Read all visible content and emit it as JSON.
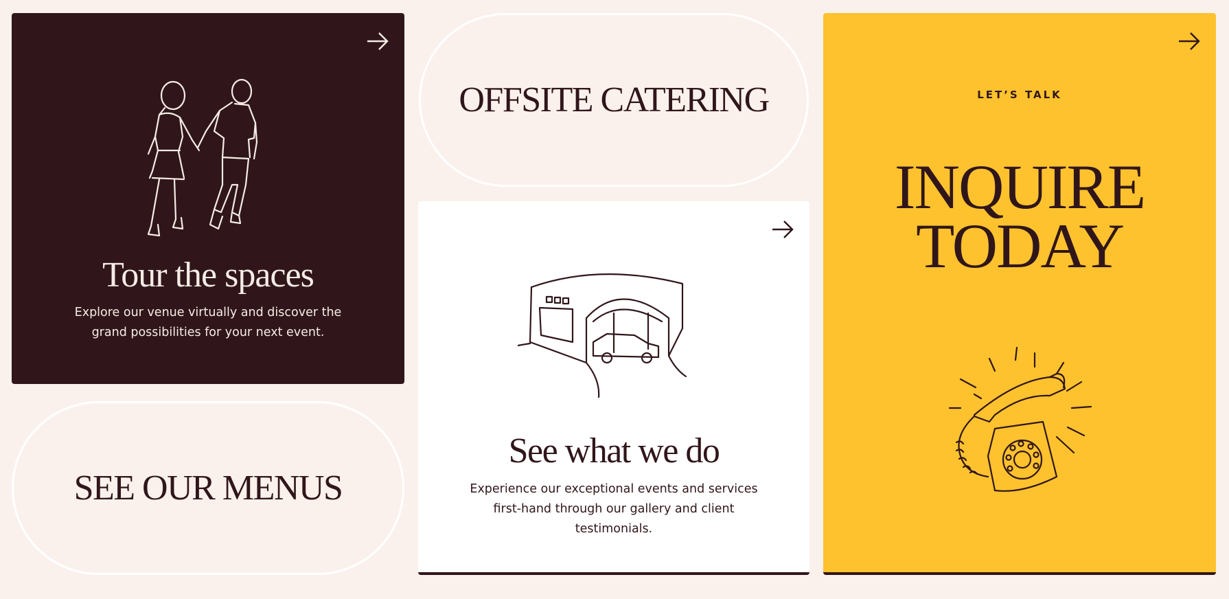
{
  "tour": {
    "title": "Tour the spaces",
    "description": "Explore our venue virtually and discover the grand possibilities for your next event.",
    "illustration": "couple-walking-icon",
    "link_icon": "arrow-right-icon"
  },
  "catering": {
    "label": "OFFSITE CATERING"
  },
  "menus": {
    "label": "SEE OUR MENUS"
  },
  "see": {
    "title": "See what we do",
    "description": "Experience our exceptional events and services first-hand through our gallery and client testimonials.",
    "illustration": "car-garage-icon",
    "link_icon": "arrow-right-icon"
  },
  "inquire": {
    "eyebrow": "LET’S TALK",
    "title_line1": "INQUIRE",
    "title_line2": "TODAY",
    "illustration": "ringing-telephone-icon",
    "link_icon": "arrow-right-icon"
  },
  "colors": {
    "background": "#faf1ec",
    "maroon": "#30161a",
    "yellow": "#fdc22e",
    "white": "#ffffff"
  }
}
